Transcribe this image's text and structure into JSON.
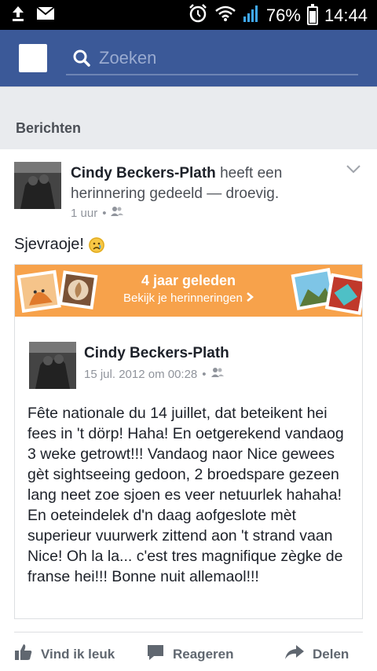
{
  "status": {
    "battery": "76%",
    "time": "14:44",
    "battery_level": 0.76,
    "icons": [
      "upload-icon",
      "mail-icon",
      "alarm-icon",
      "wifi-icon",
      "signal-icon",
      "battery-icon"
    ]
  },
  "search": {
    "placeholder": "Zoeken"
  },
  "section": {
    "title": "Berichten"
  },
  "post": {
    "author": "Cindy Beckers-Plath",
    "action": " heeft een herinnering gedeeld — droevig.",
    "time": "1 uur",
    "text": "Sjevraoje!",
    "memory": {
      "title": "4 jaar geleden",
      "subtitle": "Bekijk je herinneringen",
      "author": "Cindy Beckers-Plath",
      "date": "15 jul. 2012 om 00:28",
      "text": "Fête nationale du 14 juillet, dat beteikent hei fees in 't dörp! Haha! En oetgerekend vandaog 3 weke getrowt!!! Vandaog naor Nice gewees gèt sightseeing gedoon, 2 broedspare gezeen lang neet zoe sjoen es veer netuurlek hahaha! En oeteindelek d'n daag aofgeslote mèt superieur vuurwerk zittend aon 't strand vaan Nice! Oh la la... c'est tres magnifique zègke de franse hei!!! Bonne nuit allemaol!!!"
    }
  },
  "actions": {
    "like": "Vind ik leuk",
    "comment": "Reageren",
    "share": "Delen"
  },
  "colors": {
    "brand": "#3b5998",
    "banner": "#f7a24b"
  }
}
